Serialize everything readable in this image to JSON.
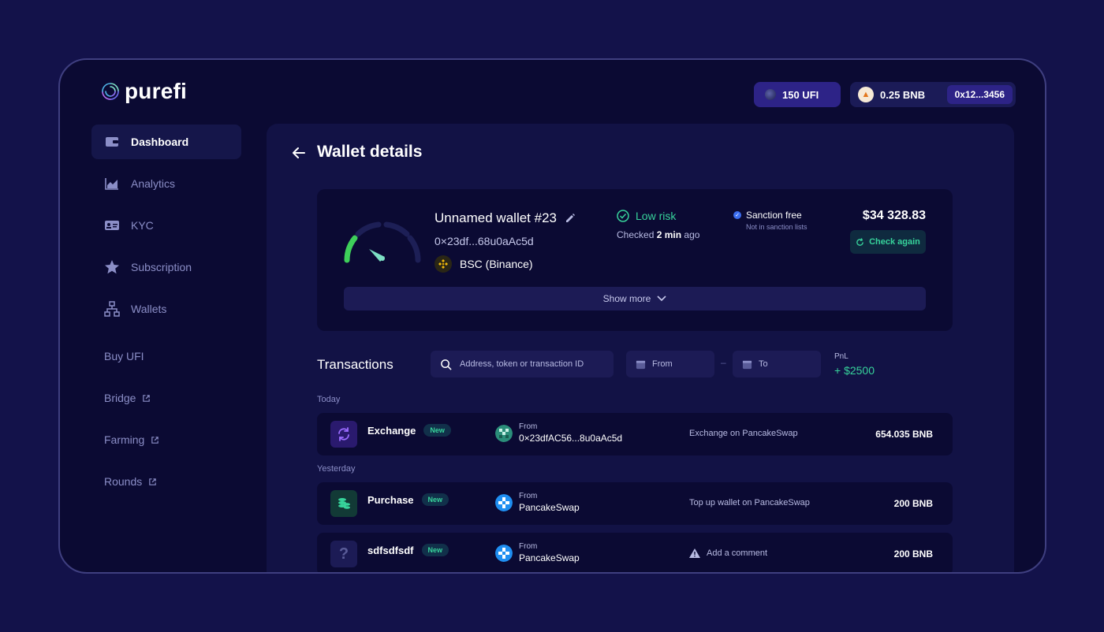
{
  "app": {
    "logo": "purefi"
  },
  "header": {
    "ufi_balance": "150 UFI",
    "bnb_balance": "0.25 BNB",
    "account_address": "0x12...3456"
  },
  "sidebar": {
    "items": [
      {
        "label": "Dashboard",
        "icon": "wallet-icon",
        "active": true
      },
      {
        "label": "Analytics",
        "icon": "chart-icon"
      },
      {
        "label": "KYC",
        "icon": "id-card-icon"
      },
      {
        "label": "Subscription",
        "icon": "star-icon"
      },
      {
        "label": "Wallets",
        "icon": "hierarchy-icon"
      }
    ],
    "links": [
      {
        "label": "Buy UFI",
        "external": false
      },
      {
        "label": "Bridge",
        "external": true
      },
      {
        "label": "Farming",
        "external": true
      },
      {
        "label": "Rounds",
        "external": true
      }
    ]
  },
  "page": {
    "title": "Wallet details"
  },
  "wallet": {
    "name": "Unnamed wallet #23",
    "address": "0×23df...68u0aAc5d",
    "chain": "BSC (Binance)",
    "risk_label": "Low risk",
    "checked_prefix": "Checked",
    "checked_time": "2 min",
    "checked_suffix": "ago",
    "sanction_label": "Sanction free",
    "sanction_sub": "Not in sanction lists",
    "balance": "$34 328.83",
    "check_again_label": "Check again",
    "show_more_label": "Show more",
    "risk_level": 0.2
  },
  "transactions": {
    "title": "Transactions",
    "search_placeholder": "Address, token or transaction ID",
    "date_from": "From",
    "date_to": "To",
    "date_separator": "–",
    "pnl_label": "PnL",
    "pnl_value": "+ $2500",
    "groups": [
      {
        "label": "Today"
      },
      {
        "label": "Yesterday"
      }
    ],
    "rows": [
      {
        "name": "Exchange",
        "badge": "New",
        "from_label": "From",
        "from_value": "0×23dfAC56...8u0aAc5d",
        "description": "Exchange on PancakeSwap",
        "amount": "654.035 BNB",
        "icon": "exchange-icon"
      },
      {
        "name": "Purchase",
        "badge": "New",
        "from_label": "From",
        "from_value": "PancakeSwap",
        "description": "Top up wallet on PancakeSwap",
        "amount": "200 BNB",
        "icon": "coins-icon"
      },
      {
        "name": "sdfsdfsdf",
        "badge": "New",
        "from_label": "From",
        "from_value": "PancakeSwap",
        "description": "Add a comment",
        "amount": "200 BNB",
        "icon": "question-icon"
      }
    ]
  },
  "colors": {
    "background": "#13124a",
    "frame": "#0b0a33",
    "panel": "#121245",
    "accent_green": "#37d39b",
    "accent_purple": "#2d2387"
  }
}
